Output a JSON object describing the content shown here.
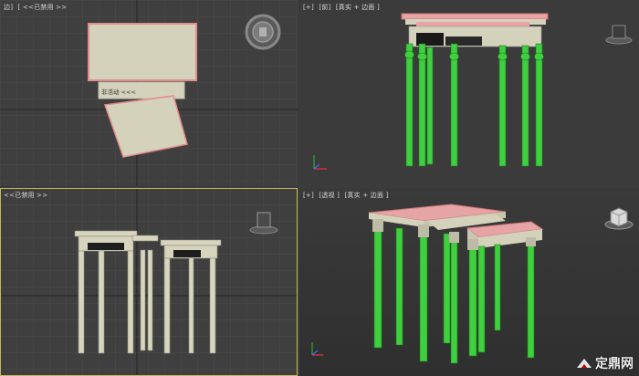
{
  "viewports": {
    "top": {
      "labels": [
        "边]",
        "[ <<已禁用 >>"
      ]
    },
    "front": {
      "labels": [
        "[+]",
        "[前]",
        "[真实 + 边面 ]"
      ]
    },
    "left": {
      "labels": [
        "<<已禁用 >>"
      ]
    },
    "persp": {
      "labels": [
        "[+]",
        "[透视 ]",
        "[真实 + 边面 ]"
      ]
    }
  },
  "top_view_popup": {
    "text": "非活动 <<<"
  },
  "watermark": {
    "text": "定鼎网"
  },
  "colors": {
    "viewport_bg": "#3f3f3f",
    "grid": "#4a4a4a",
    "table_top_pink": "#e7a4a4",
    "leg_green": "#3fcf3f",
    "cream": "#d6d3bf",
    "active_border": "#c9b45a"
  },
  "icons": [
    "viewcube-icon",
    "steering-wheel-icon",
    "watermark-logo-icon"
  ]
}
